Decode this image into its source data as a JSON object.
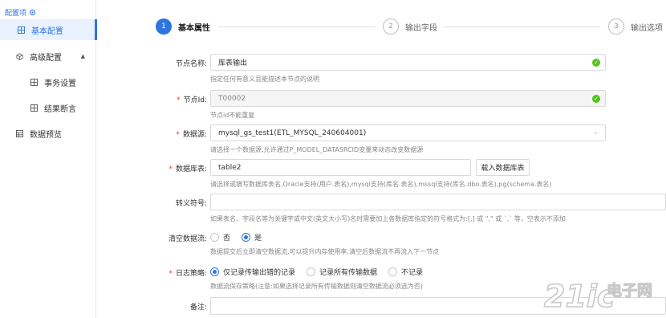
{
  "sidebar": {
    "title": "配置项",
    "items": [
      {
        "label": "基本配置"
      },
      {
        "label": "高级配置"
      },
      {
        "label": "事务设置"
      },
      {
        "label": "结果断言"
      },
      {
        "label": "数据预览"
      }
    ]
  },
  "steps": [
    {
      "num": "1",
      "label": "基本属性"
    },
    {
      "num": "2",
      "label": "输出字段"
    },
    {
      "num": "3",
      "label": "输出选项"
    }
  ],
  "form": {
    "node_name": {
      "label": "节点名称:",
      "value": "库表输出",
      "help": "指定任何有意义且能描述本节点的说明"
    },
    "node_id": {
      "label": "节点Id:",
      "value": "T00002",
      "help": "节点id不能重复"
    },
    "datasource": {
      "label": "数据源:",
      "value": "mysql_gs_test1(ETL_MYSQL_240604001)",
      "help": "请选择一个数据源,允许通过P_MODEL_DATASRCID变量来动态改变数据源"
    },
    "table": {
      "label": "数据库表:",
      "value": "table2",
      "button": "载入数据库表",
      "help": "请选择或填写数据库表名,Oracle支持(用户.表名),mysql支持(库名.表名),mssql支持(库名.dbo.表名),pg(schema.表名)"
    },
    "escape": {
      "label": "转义符号:",
      "value": "",
      "help": "如果表名、字段名等为关键字或中文(英文大小写)名时需要加上各数据库指定的符号格式为:[,] 或 \",\" 或 `,` 等，空表示不添加"
    },
    "clear": {
      "label": "清空数据流:",
      "options": [
        "否",
        "是"
      ],
      "help": "数据提交后立即清空数据流,可以提升内存使用率,清空后数据流不再流入下一节点"
    },
    "log": {
      "label": "日志策略:",
      "options": [
        "仅记录传输出错的记录",
        "记录所有传输数据",
        "不记录"
      ],
      "help": "数据流保存策略(注意:如果选择记录所有传输数据则清空数据流必须选为否)"
    },
    "remark": {
      "label": "备注:",
      "value": ""
    }
  },
  "colors": {
    "accent": "#2d74e0",
    "success": "#52c41a",
    "required": "#e33333"
  },
  "watermark": {
    "text": "21ic电子网"
  }
}
